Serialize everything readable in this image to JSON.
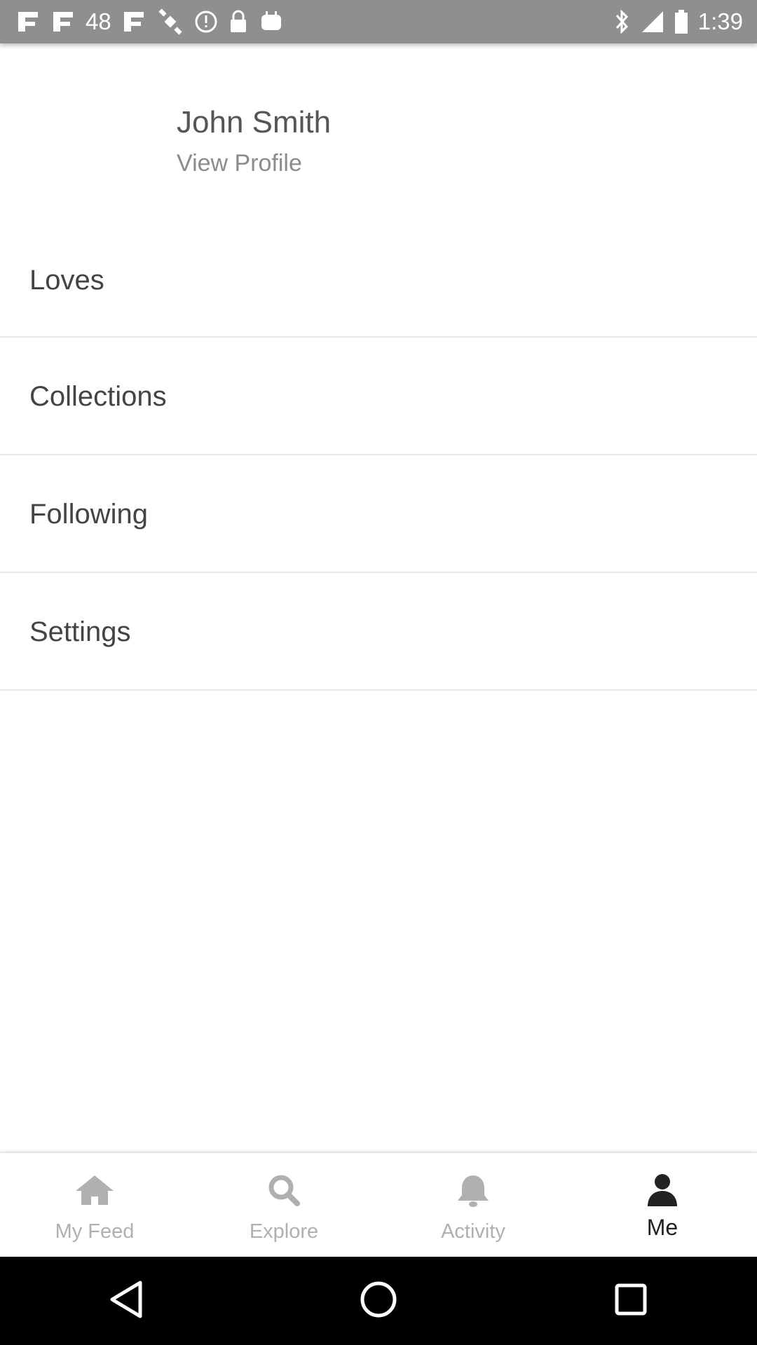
{
  "status_bar": {
    "left_number": "48",
    "time": "1:39",
    "icons_left": [
      "app-icon",
      "app-icon",
      "app-icon",
      "satellite-icon",
      "alert-icon",
      "lock-icon",
      "android-icon"
    ],
    "icons_right": [
      "bluetooth-icon",
      "signal-icon",
      "battery-icon"
    ]
  },
  "profile": {
    "name": "John Smith",
    "link": "View Profile"
  },
  "menu": {
    "items": [
      {
        "label": "Loves"
      },
      {
        "label": "Collections"
      },
      {
        "label": "Following"
      },
      {
        "label": "Settings"
      }
    ]
  },
  "tabs": [
    {
      "label": "My Feed",
      "icon": "home-icon",
      "active": false
    },
    {
      "label": "Explore",
      "icon": "search-icon",
      "active": false
    },
    {
      "label": "Activity",
      "icon": "bell-icon",
      "active": false
    },
    {
      "label": "Me",
      "icon": "person-icon",
      "active": true
    }
  ],
  "colors": {
    "status_bar": "#8f8f8f",
    "inactive_tab": "#b0b0b0",
    "active_tab": "#222222",
    "text": "#444444"
  }
}
